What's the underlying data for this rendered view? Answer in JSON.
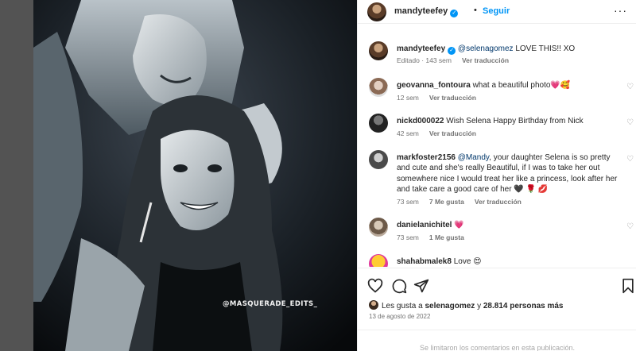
{
  "post": {
    "author": "mandyteefey",
    "follow_label": "Seguir",
    "separator": "•",
    "more_label": "···",
    "watermark": "@MASQUERADE_EDITS_"
  },
  "caption": {
    "user": "mandyteefey",
    "mention": "@selenagomez",
    "text": " LOVE THIS!! XO",
    "meta_time": "Editado · 143 sem",
    "see_translation": "Ver traducción"
  },
  "comments": [
    {
      "user": "geovanna_fontoura",
      "text": " what a beautiful photo💗🥰",
      "time": "12 sem",
      "translate": "Ver traducción"
    },
    {
      "user": "nickd000022",
      "text": " Wish Selena Happy Birthday from Nick",
      "time": "42 sem",
      "translate": "Ver traducción"
    },
    {
      "user": "markfoster2156",
      "mention": "@Mandy",
      "text": ", your daughter Selena is so pretty and cute and she's really Beautiful, if I was to take her out somewhere nice I would treat her like a princess, look after her and take care a good care of her 🖤 🌹 💋",
      "time": "73 sem",
      "likes": "7 Me gusta",
      "translate": "Ver traducción"
    },
    {
      "user": "danielanichitel",
      "text": " 💗",
      "time": "73 sem",
      "likes": "1 Me gusta"
    },
    {
      "user": "shahabmalek8",
      "text": " Love 😍"
    }
  ],
  "engagement": {
    "liked_prefix": "Les gusta a ",
    "liked_user": "selenagomez",
    "liked_mid": " y ",
    "liked_count": "28.814 personas más",
    "date": "13 de agosto de 2022",
    "comments_limited": "Se limitaron los comentarios en esta publicación."
  },
  "icons": [
    "verified-icon",
    "heart-icon",
    "comment-icon",
    "share-icon",
    "save-icon",
    "more-icon"
  ],
  "colors": {
    "link": "#0095f6",
    "mention": "#00376b",
    "meta": "#737373",
    "border": "#efefef"
  }
}
